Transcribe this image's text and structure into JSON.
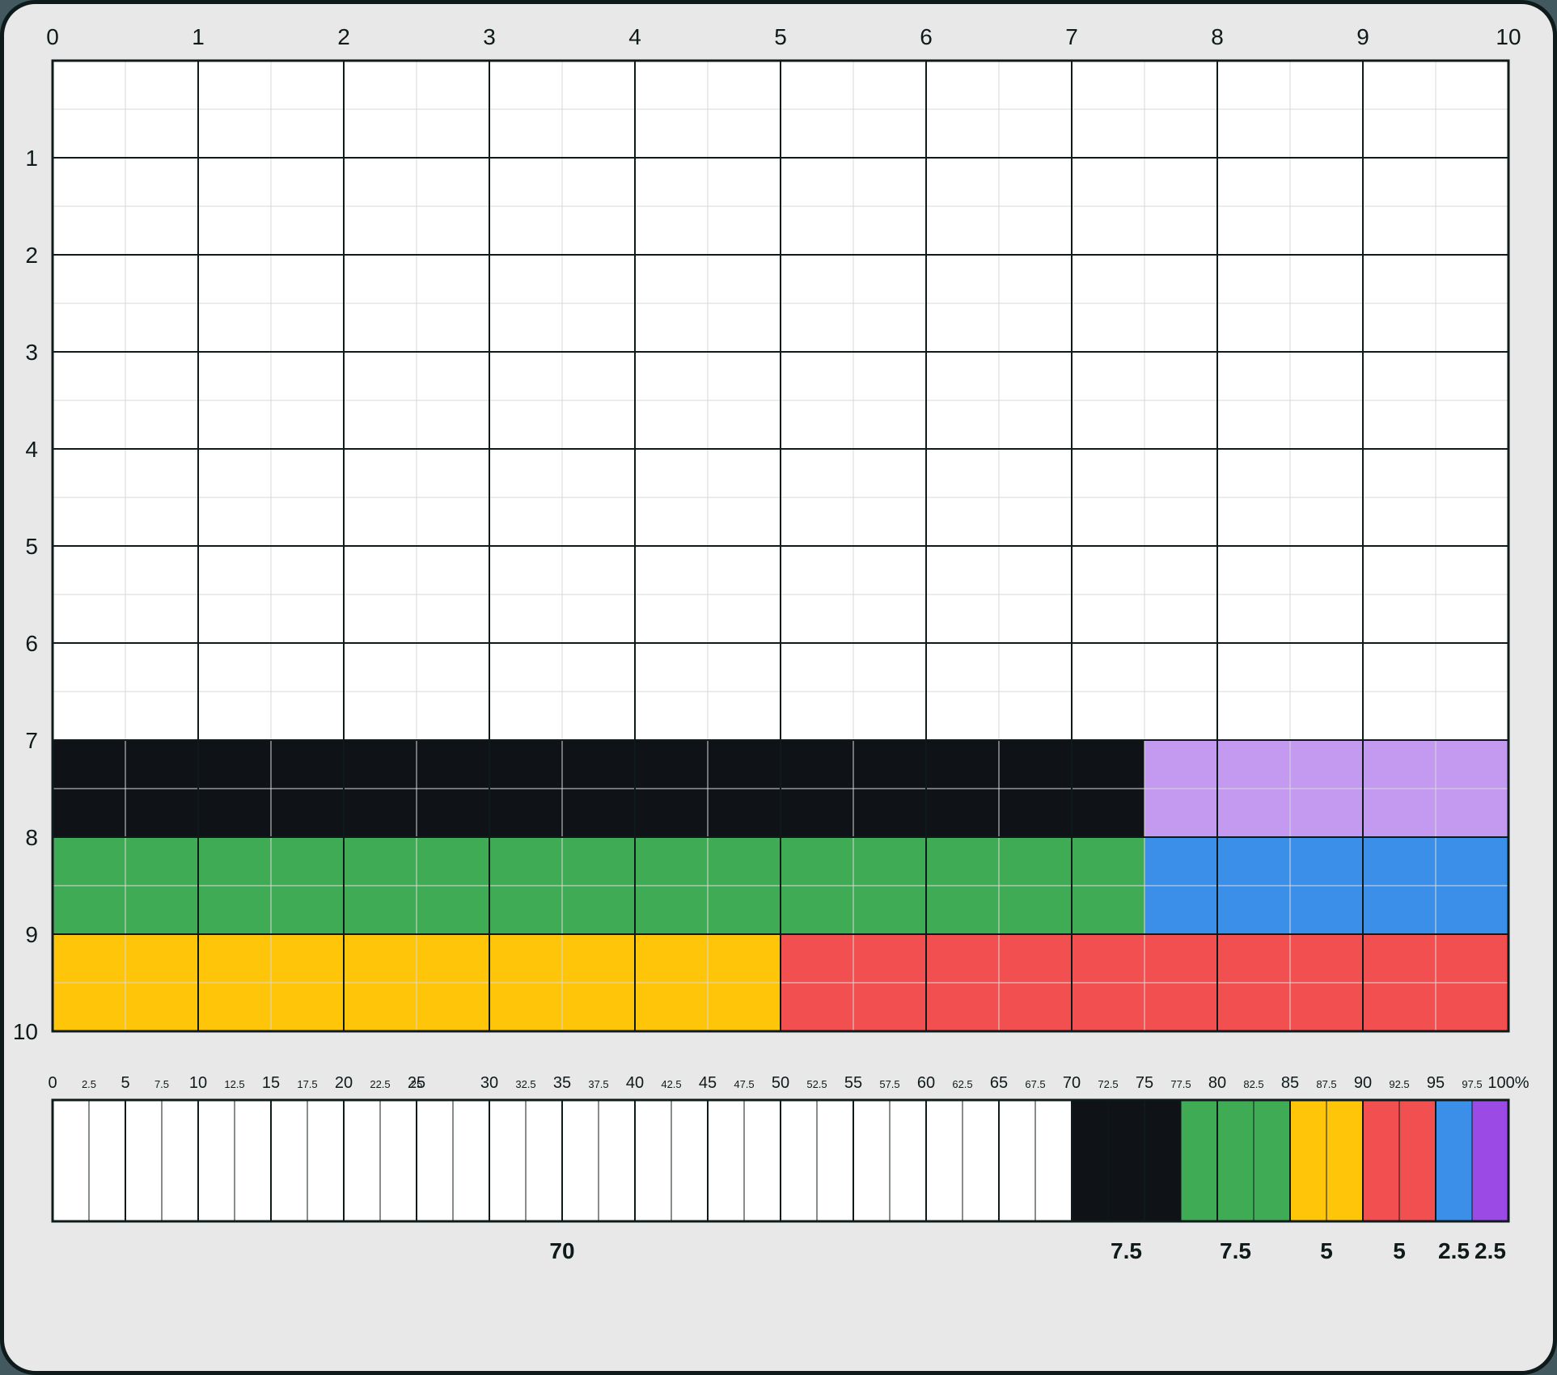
{
  "chart_data": {
    "type": "area",
    "grid": {
      "x_range": [
        0,
        10
      ],
      "y_range": [
        0,
        10
      ],
      "x_ticks": [
        0,
        1,
        2,
        3,
        4,
        5,
        6,
        7,
        8,
        9,
        10
      ],
      "y_ticks": [
        1,
        2,
        3,
        4,
        5,
        6,
        7,
        8,
        9,
        10
      ],
      "major_step": 1,
      "minor_step": 0.5
    },
    "blocks": [
      {
        "name": "white",
        "row_start": 0,
        "row_end": 7,
        "col_start": 0,
        "col_end": 10,
        "color": "#ffffff",
        "percent": 70
      },
      {
        "name": "black",
        "row_start": 7,
        "row_end": 8,
        "col_start": 0,
        "col_end": 7.5,
        "color": "#0f1216",
        "percent": 7.5
      },
      {
        "name": "purple",
        "row_start": 7,
        "row_end": 8,
        "col_start": 7.5,
        "col_end": 10,
        "color": "#c49af0",
        "percent": 2.5
      },
      {
        "name": "green",
        "row_start": 8,
        "row_end": 9,
        "col_start": 0,
        "col_end": 7.5,
        "color": "#3fab55",
        "percent": 7.5
      },
      {
        "name": "blue",
        "row_start": 8,
        "row_end": 9,
        "col_start": 7.5,
        "col_end": 10,
        "color": "#3c8fe8",
        "percent": 2.5
      },
      {
        "name": "yellow",
        "row_start": 9,
        "row_end": 10,
        "col_start": 0,
        "col_end": 5,
        "color": "#ffc508",
        "percent": 5
      },
      {
        "name": "red",
        "row_start": 9,
        "row_end": 10,
        "col_start": 5,
        "col_end": 10,
        "color": "#f25050",
        "percent": 5
      }
    ],
    "percent_axis": {
      "range": [
        0,
        100
      ],
      "major_step": 5,
      "minor_step": 2.5,
      "ticks_major": [
        0,
        5,
        10,
        15,
        20,
        25,
        30,
        35,
        40,
        45,
        50,
        55,
        60,
        65,
        70,
        75,
        80,
        85,
        90,
        95,
        100
      ],
      "ticks_minor": [
        2.5,
        7.5,
        12.5,
        17.5,
        22.5,
        25,
        32.5,
        37.5,
        42.5,
        47.5,
        52.5,
        57.5,
        62.5,
        67.5,
        72.5,
        77.5,
        82.5,
        87.5,
        92.5,
        97.5
      ],
      "unit": "%"
    },
    "percent_bar": [
      {
        "name": "white",
        "start": 0,
        "end": 70,
        "color": "#ffffff",
        "label": "70"
      },
      {
        "name": "black",
        "start": 70,
        "end": 77.5,
        "color": "#0f1216",
        "label": "7.5"
      },
      {
        "name": "green",
        "start": 77.5,
        "end": 85,
        "color": "#3fab55",
        "label": "7.5"
      },
      {
        "name": "yellow",
        "start": 85,
        "end": 90,
        "color": "#ffc508",
        "label": "5"
      },
      {
        "name": "red",
        "start": 90,
        "end": 95,
        "color": "#f25050",
        "label": "5"
      },
      {
        "name": "blue",
        "start": 95,
        "end": 97.5,
        "color": "#3c8fe8",
        "label": "2.5"
      },
      {
        "name": "purple",
        "start": 97.5,
        "end": 100,
        "color": "#9b4ae6",
        "label": "2.5"
      }
    ]
  }
}
